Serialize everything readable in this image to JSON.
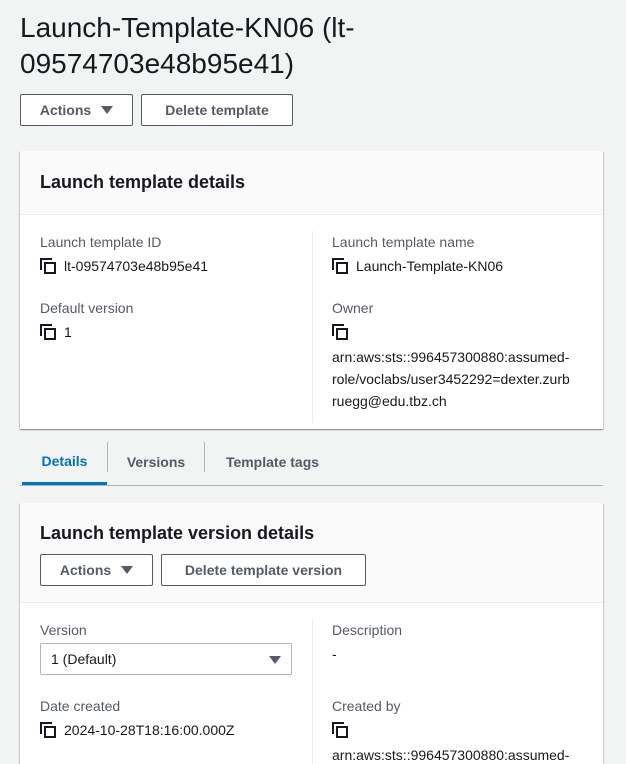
{
  "page": {
    "title": "Launch-Template-KN06 (lt-09574703e48b95e41)"
  },
  "toolbar": {
    "actions_label": "Actions",
    "delete_label": "Delete template"
  },
  "details_panel": {
    "title": "Launch template details",
    "template_id_label": "Launch template ID",
    "template_id_value": "lt-09574703e48b95e41",
    "template_name_label": "Launch template name",
    "template_name_value": "Launch-Template-KN06",
    "default_version_label": "Default version",
    "default_version_value": "1",
    "owner_label": "Owner",
    "owner_value_line1": "arn:aws:sts::996457300880:assumed-",
    "owner_value_line2": "role/voclabs/user3452292=dexter.zurb",
    "owner_value_line3": "ruegg@edu.tbz.ch"
  },
  "tabs": [
    {
      "label": "Details",
      "active": true
    },
    {
      "label": "Versions",
      "active": false
    },
    {
      "label": "Template tags",
      "active": false
    }
  ],
  "version_panel": {
    "title": "Launch template version details",
    "actions_label": "Actions",
    "delete_label": "Delete template version",
    "version_label": "Version",
    "version_selected": "1 (Default)",
    "description_label": "Description",
    "description_value": "-",
    "date_created_label": "Date created",
    "date_created_value": "2024-10-28T18:16:00.000Z",
    "created_by_label": "Created by",
    "created_by_value_line1": "arn:aws:sts::996457300880:assumed-"
  },
  "colors": {
    "background": "#f2f3f3",
    "active_tab": "#0073bb",
    "text": "#16191f",
    "secondary_text": "#545b64"
  }
}
